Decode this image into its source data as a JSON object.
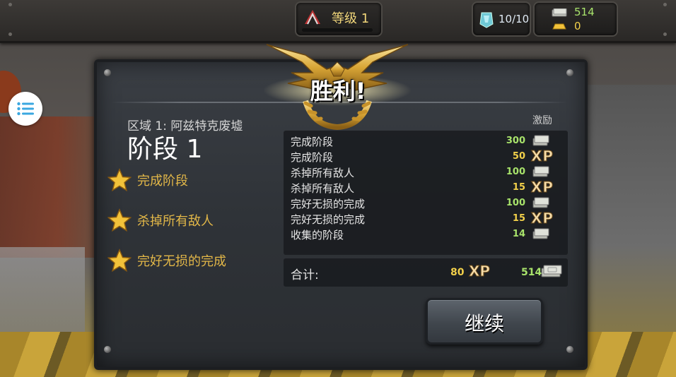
{
  "topbar": {
    "level_label": "等级 1",
    "level_progress": 0,
    "energy": "10/10",
    "cash": "514",
    "gold": "0"
  },
  "panel": {
    "victory": "胜利!",
    "zone": "区域 1: 阿兹特克废墟",
    "stage": "阶段 1",
    "objectives": [
      {
        "label": "完成阶段",
        "icon": "gold-star-icon"
      },
      {
        "label": "杀掉所有敌人",
        "icon": "gold-star-icon"
      },
      {
        "label": "完好无损的完成",
        "icon": "gold-star-icon"
      }
    ],
    "reward_header": "激励",
    "rewards": [
      {
        "label": "完成阶段",
        "value": "300",
        "kind": "cash"
      },
      {
        "label": "完成阶段",
        "value": "50",
        "kind": "xp"
      },
      {
        "label": "杀掉所有敌人",
        "value": "100",
        "kind": "cash"
      },
      {
        "label": "杀掉所有敌人",
        "value": "15",
        "kind": "xp"
      },
      {
        "label": "完好无损的完成",
        "value": "100",
        "kind": "cash"
      },
      {
        "label": "完好无损的完成",
        "value": "15",
        "kind": "xp"
      },
      {
        "label": "收集的阶段",
        "value": "14",
        "kind": "cash"
      }
    ],
    "xp_glyph": "XP",
    "total_label": "合计:",
    "total_xp": "80",
    "total_cash": "514",
    "continue_label": "继续"
  },
  "colors": {
    "cash_green": "#a8e36b",
    "xp_gold": "#f2d04a",
    "objective_gold": "#e2b748"
  }
}
